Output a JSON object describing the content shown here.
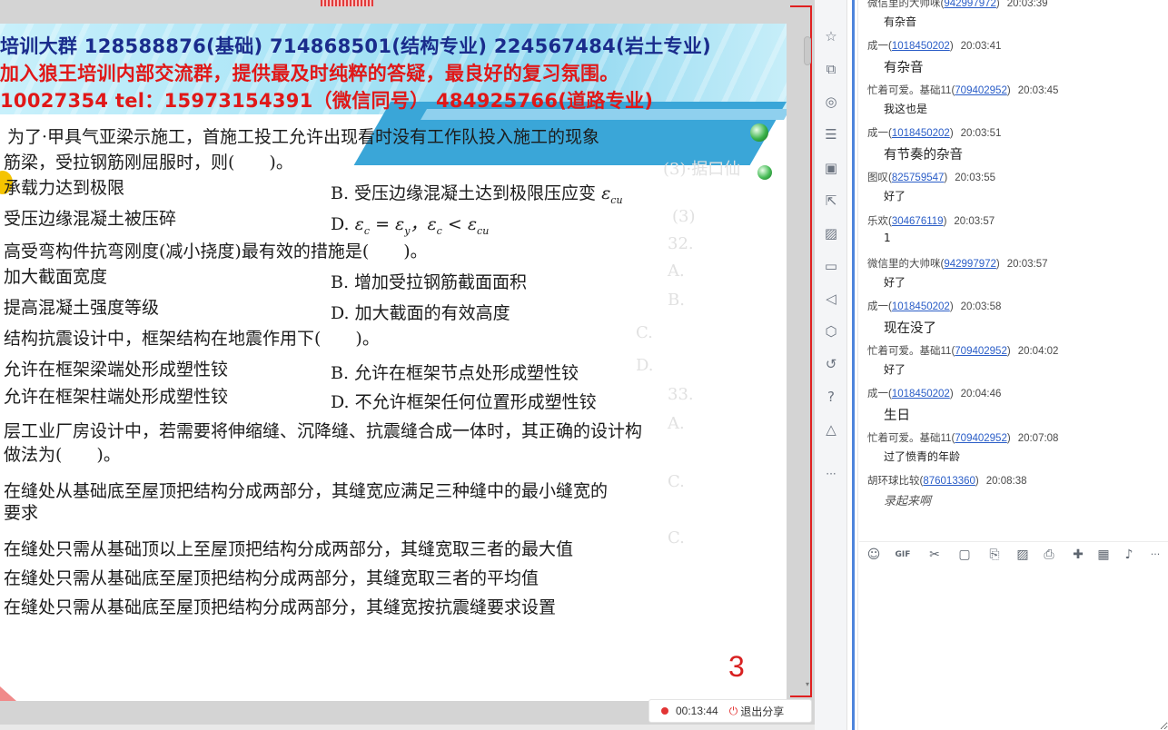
{
  "slide": {
    "banner": {
      "line1": "培训大群 128588876(基础) 714868501(结构专业) 224567484(岩土专业)",
      "line2": "加入狼王培训内部交流群，提供最及时纯粹的答疑，最良好的复习氛围。",
      "line3": "10027354   tel：15973154391（微信同号）   484925766(道路专业)"
    },
    "lines": [
      "为了·甲具气亚梁示施工，首施工投工允许出现看时没有工作队投入施工的现象",
      "筋梁，受拉钢筋刚屈服时，则(　　)。",
      "承载力达到极限",
      "B. 受压边缘混凝土达到极限压应变",
      "受压边缘混凝土被压碎",
      "D.",
      "高受弯构件抗弯刚度(减小挠度)最有效的措施是(　　)。",
      "加大截面宽度",
      "B. 增加受拉钢筋截面面积",
      "提高混凝土强度等级",
      "D. 加大截面的有效高度",
      "结构抗震设计中，框架结构在地震作用下(　　)。",
      "允许在框架梁端处形成塑性铰",
      "B. 允许在框架节点处形成塑性铰",
      "允许在框架柱端处形成塑性铰",
      "D. 不允许框架任何位置形成塑性铰",
      "层工业厂房设计中，若需要将伸缩缝、沉降缝、抗震缝合成一体时，其正确的设计构",
      "做法为(　　)。",
      "在缝处从基础底至屋顶把结构分成两部分，其缝宽应满足三种缝中的最小缝宽的",
      "要求",
      "在缝处只需从基础顶以上至屋顶把结构分成两部分，其缝宽取三者的最大值",
      "在缝处只需从基础底至屋顶把结构分成两部分，其缝宽取三者的平均值",
      "在缝处只需从基础底至屋顶把结构分成两部分，其缝宽按抗震缝要求设置"
    ],
    "page_number": "3"
  },
  "share_bar": {
    "timer": "00:13:44",
    "exit_label": "退出分享"
  },
  "toolbar_icons": [
    "pin-icon",
    "screenshot-icon",
    "shapes-icon",
    "sliders-icon",
    "image-gallery-icon",
    "share-out-icon",
    "picture-icon",
    "archive-icon",
    "volume-icon",
    "shield-icon",
    "history-icon",
    "help-icon",
    "eraser-icon",
    "more-icon"
  ],
  "chat": {
    "messages": [
      {
        "name": "微信里的大帅咪",
        "uid": "942997972",
        "time": "20:03:39",
        "text": "有杂音",
        "size": "small"
      },
      {
        "name": "成一",
        "uid": "1018450202",
        "time": "20:03:41",
        "text": "有杂音",
        "size": "big"
      },
      {
        "name": "忙着可爱。基础11",
        "uid": "709402952",
        "time": "20:03:45",
        "text": "我这也是",
        "size": "small"
      },
      {
        "name": "成一",
        "uid": "1018450202",
        "time": "20:03:51",
        "text": "有节奏的杂音",
        "size": "big"
      },
      {
        "name": "图叹",
        "uid": "825759547",
        "time": "20:03:55",
        "text": "好了",
        "size": "small"
      },
      {
        "name": "乐欢",
        "uid": "304676119",
        "time": "20:03:57",
        "text": "1",
        "size": "small"
      },
      {
        "name": "微信里的大帅咪",
        "uid": "942997972",
        "time": "20:03:57",
        "text": "好了",
        "size": "small"
      },
      {
        "name": "成一",
        "uid": "1018450202",
        "time": "20:03:58",
        "text": "现在没了",
        "size": "big"
      },
      {
        "name": "忙着可爱。基础11",
        "uid": "709402952",
        "time": "20:04:02",
        "text": "好了",
        "size": "small"
      },
      {
        "name": "成一",
        "uid": "1018450202",
        "time": "20:04:46",
        "text": "生日",
        "size": "big"
      },
      {
        "name": "忙着可爱。基础11",
        "uid": "709402952",
        "time": "20:07:08",
        "text": "过了愤青的年龄",
        "size": "small"
      },
      {
        "name": "胡环球比较",
        "uid": "876013360",
        "time": "20:08:38",
        "text": "录起来啊",
        "size": "hand"
      }
    ],
    "toolbar_icons": [
      "emoji-icon",
      "gif-icon",
      "scissors-icon",
      "folder-icon",
      "doc-icon",
      "image-icon",
      "print-icon",
      "gift-icon",
      "calendar-icon",
      "bell-icon",
      "more-icon"
    ]
  }
}
